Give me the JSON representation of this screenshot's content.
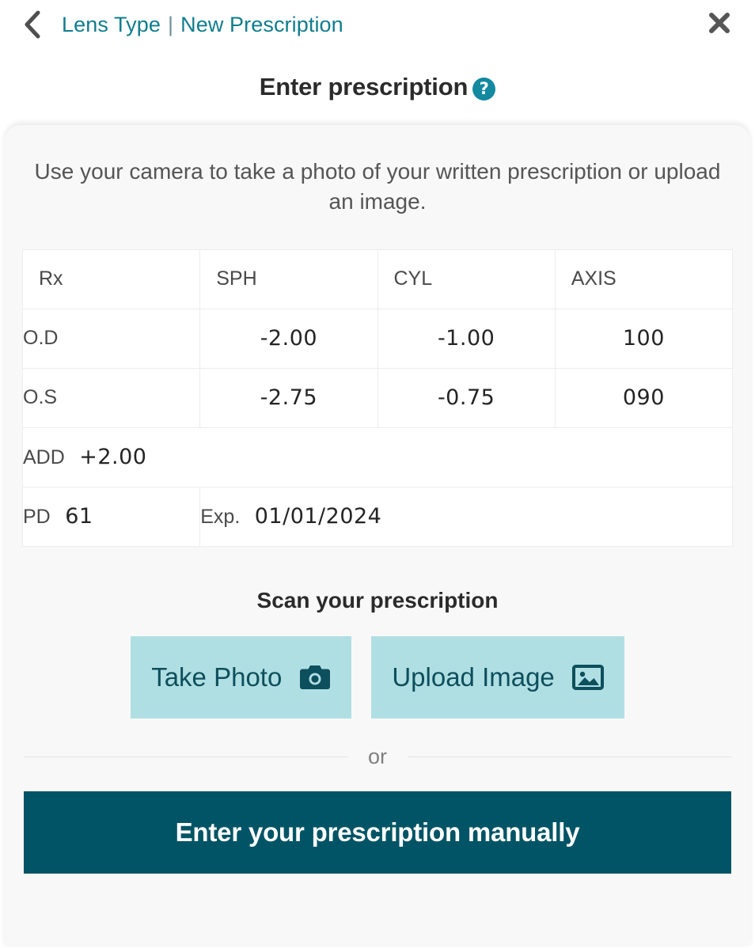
{
  "header": {
    "back_icon": "chevron-left-icon",
    "breadcrumb": {
      "parent": "Lens Type",
      "separator": "|",
      "current": "New Prescription"
    },
    "close_icon": "close-icon"
  },
  "title": {
    "text": "Enter prescription",
    "help_icon": "help-question-icon",
    "help_glyph": "?"
  },
  "intro": "Use your camera to take a photo of your written prescription or upload an image.",
  "table": {
    "columns": [
      "Rx",
      "SPH",
      "CYL",
      "AXIS"
    ],
    "rows": [
      {
        "label": "O.D",
        "sph": "-2.00",
        "cyl": "-1.00",
        "axis": "100"
      },
      {
        "label": "O.S",
        "sph": "-2.75",
        "cyl": "-0.75",
        "axis": "090"
      }
    ],
    "add": {
      "label": "ADD",
      "value": "+2.00"
    },
    "pd": {
      "label": "PD",
      "value": "61"
    },
    "exp": {
      "label": "Exp.",
      "value": "01/01/2024"
    }
  },
  "scan": {
    "heading": "Scan your prescription",
    "take_photo": {
      "label": "Take Photo",
      "icon": "camera-icon"
    },
    "upload_image": {
      "label": "Upload Image",
      "icon": "image-icon"
    }
  },
  "divider": {
    "text": "or"
  },
  "manual_button": {
    "label": "Enter your prescription manually"
  },
  "colors": {
    "teal_link": "#0f7d8d",
    "teal_dark": "#015465",
    "teal_light": "#b0dfe3",
    "help_badge": "#1389a0",
    "card_bg": "#f8f8f8",
    "text_dark": "#2b2b2b",
    "text_muted": "#555555"
  }
}
